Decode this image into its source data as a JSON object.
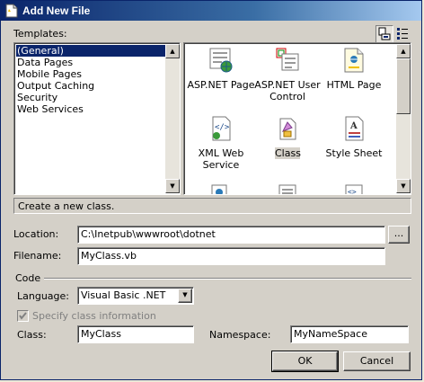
{
  "window": {
    "title": "Add New File"
  },
  "templates_label": "Templates:",
  "categories": [
    {
      "label": "(General)",
      "selected": true
    },
    {
      "label": "Data Pages",
      "selected": false
    },
    {
      "label": "Mobile Pages",
      "selected": false
    },
    {
      "label": "Output Caching",
      "selected": false
    },
    {
      "label": "Security",
      "selected": false
    },
    {
      "label": "Web Services",
      "selected": false
    }
  ],
  "templates": [
    {
      "label": "ASP.NET Page",
      "icon": "aspnet-page-icon"
    },
    {
      "label": "ASP.NET User Control",
      "icon": "user-control-icon"
    },
    {
      "label": "HTML Page",
      "icon": "html-page-icon"
    },
    {
      "label": "XML Web Service",
      "icon": "xml-web-service-icon"
    },
    {
      "label": "Class",
      "icon": "class-icon",
      "selected": true
    },
    {
      "label": "Style Sheet",
      "icon": "style-sheet-icon"
    }
  ],
  "description": "Create a new class.",
  "location": {
    "label": "Location:",
    "value": "C:\\Inetpub\\wwwroot\\dotnet",
    "browse_label": "..."
  },
  "filename": {
    "label": "Filename:",
    "value": "MyClass.vb"
  },
  "code_group": {
    "label": "Code"
  },
  "language": {
    "label": "Language:",
    "value": "Visual Basic .NET"
  },
  "specify_class": {
    "label": "Specify class information",
    "checked": true,
    "enabled": false
  },
  "class_field": {
    "label": "Class:",
    "value": "MyClass"
  },
  "namespace_field": {
    "label": "Namespace:",
    "value": "MyNameSpace"
  },
  "buttons": {
    "ok": "OK",
    "cancel": "Cancel"
  },
  "colors": {
    "titlebar_start": "#0a246a",
    "selection": "#0a246a",
    "dialog_bg": "#d4d0c8"
  }
}
